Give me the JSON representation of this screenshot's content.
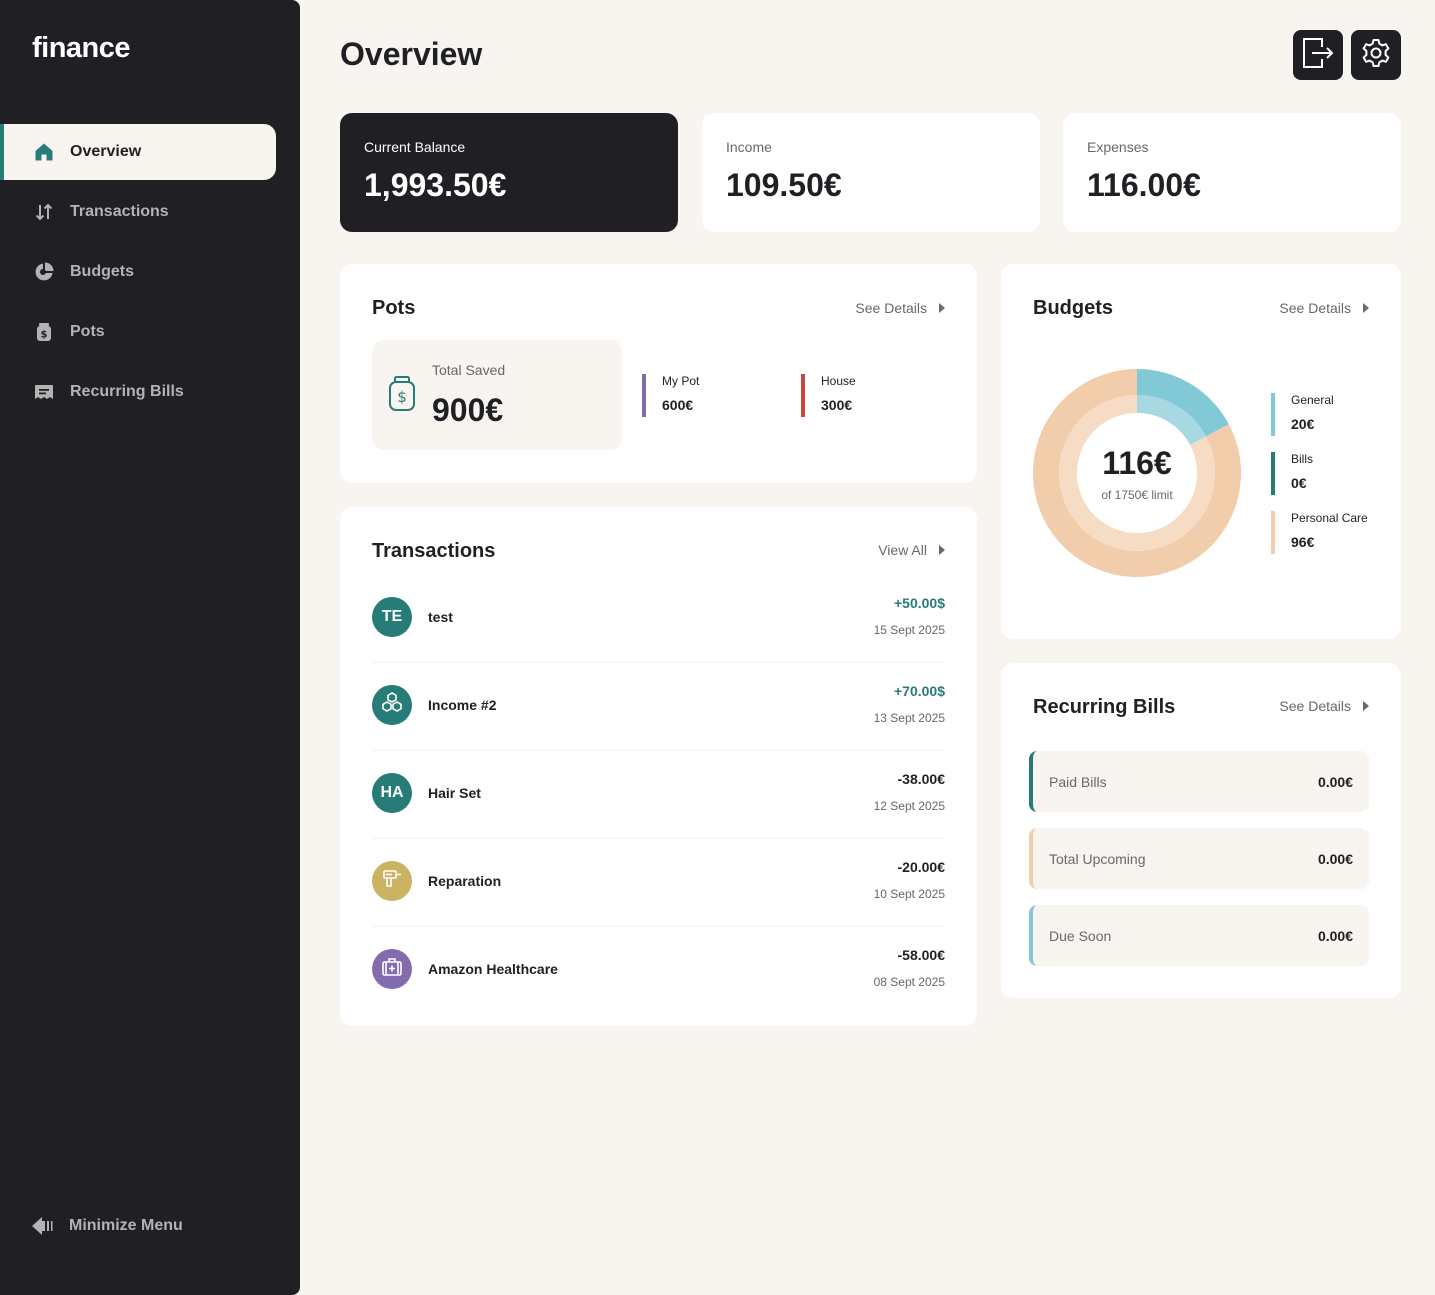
{
  "app": {
    "logo": "finance"
  },
  "sidebar": {
    "items": [
      {
        "label": "Overview",
        "icon": "home-icon",
        "active": true
      },
      {
        "label": "Transactions",
        "icon": "arrows-up-down-icon",
        "active": false
      },
      {
        "label": "Budgets",
        "icon": "pie-chart-icon",
        "active": false
      },
      {
        "label": "Pots",
        "icon": "jar-icon",
        "active": false
      },
      {
        "label": "Recurring Bills",
        "icon": "receipt-icon",
        "active": false
      }
    ],
    "minimize_label": "Minimize Menu"
  },
  "header": {
    "title": "Overview",
    "actions": [
      "logout-icon",
      "settings-icon"
    ]
  },
  "summary": {
    "balance": {
      "label": "Current Balance",
      "value": "1,993.50€"
    },
    "income": {
      "label": "Income",
      "value": "109.50€"
    },
    "expenses": {
      "label": "Expenses",
      "value": "116.00€"
    }
  },
  "pots": {
    "title": "Pots",
    "link": "See Details",
    "total_label": "Total Saved",
    "total_value": "900€",
    "items": [
      {
        "name": "My Pot",
        "value": "600€",
        "color": "#826CB0"
      },
      {
        "name": "House",
        "value": "300€",
        "color": "#C94736"
      }
    ]
  },
  "transactions": {
    "title": "Transactions",
    "link": "View All",
    "items": [
      {
        "name": "test",
        "avatar_text": "TE",
        "avatar_color": "#277C78",
        "amount": "+50.00$",
        "positive": true,
        "date": "15 Sept 2025"
      },
      {
        "name": "Income #2",
        "avatar_text": "",
        "avatar_icon": "cubes-icon",
        "avatar_color": "#277C78",
        "amount": "+70.00$",
        "positive": true,
        "date": "13 Sept 2025"
      },
      {
        "name": "Hair Set",
        "avatar_text": "HA",
        "avatar_color": "#277C78",
        "amount": "-38.00€",
        "positive": false,
        "date": "12 Sept 2025"
      },
      {
        "name": "Reparation",
        "avatar_text": "",
        "avatar_icon": "drill-icon",
        "avatar_color": "#CAB361",
        "amount": "-20.00€",
        "positive": false,
        "date": "10 Sept 2025"
      },
      {
        "name": "Amazon Healthcare",
        "avatar_text": "",
        "avatar_icon": "first-aid-kit-icon",
        "avatar_color": "#826CB0",
        "amount": "-58.00€",
        "positive": false,
        "date": "08 Sept 2025"
      }
    ]
  },
  "budgets": {
    "title": "Budgets",
    "link": "See Details",
    "spent": "116€",
    "limit_text": "of 1750€ limit",
    "items": [
      {
        "name": "General",
        "value": "20€",
        "amount": 20,
        "color": "#82C9D7"
      },
      {
        "name": "Bills",
        "value": "0€",
        "amount": 0,
        "color": "#277C78"
      },
      {
        "name": "Personal Care",
        "value": "96€",
        "amount": 96,
        "color": "#F2CDAC"
      }
    ]
  },
  "recurring": {
    "title": "Recurring Bills",
    "link": "See Details",
    "items": [
      {
        "label": "Paid Bills",
        "value": "0.00€",
        "color": "#277C78"
      },
      {
        "label": "Total Upcoming",
        "value": "0.00€",
        "color": "#F2CDAC"
      },
      {
        "label": "Due Soon",
        "value": "0.00€",
        "color": "#82C9D7"
      }
    ]
  }
}
